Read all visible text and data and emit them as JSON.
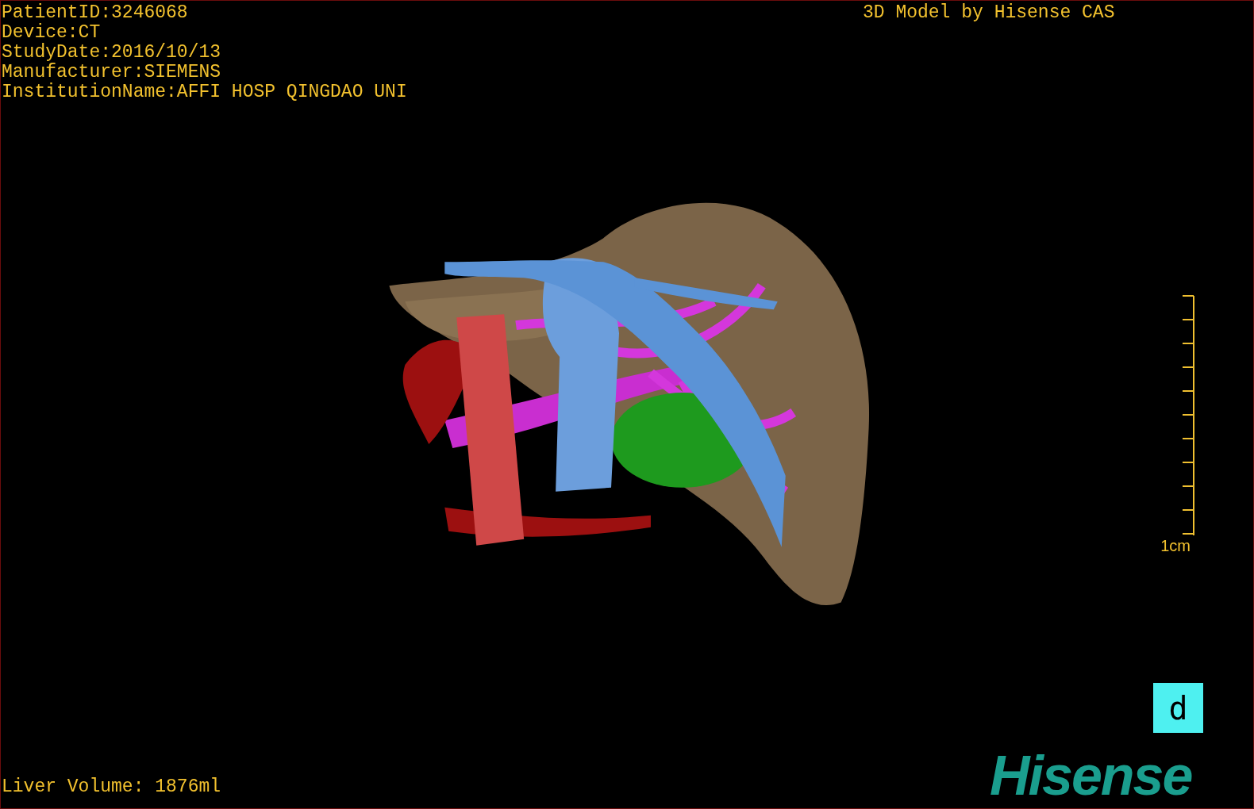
{
  "patient_info": [
    "PatientID:3246068",
    "Device:CT",
    "StudyDate:2016/10/13",
    "Manufacturer:SIEMENS",
    "InstitutionName:AFFI HOSP QINGDAO UNI"
  ],
  "title": "3D Model by Hisense CAS",
  "scale_label": "1cm",
  "view_button": "d",
  "logo": "Hisense",
  "volume": "Liver Volume: 1876ml"
}
